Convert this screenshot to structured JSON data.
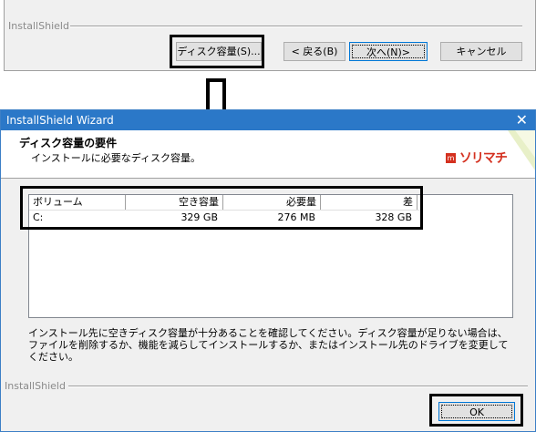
{
  "top_dialog": {
    "footer_label": "InstallShield",
    "buttons": {
      "disk_space": "ディスク容量(S)...",
      "back": "< 戻る(B)",
      "next": "次へ(N)>",
      "cancel": "キャンセル"
    }
  },
  "wizard": {
    "window_title": "InstallShield Wizard",
    "close_glyph": "✕",
    "header_title": "ディスク容量の要件",
    "header_subtitle": "インストールに必要なディスク容量。",
    "logo_mark": "m",
    "logo_text": "ソリマチ",
    "table": {
      "columns": [
        "ボリューム",
        "空き容量",
        "必要量",
        "差"
      ],
      "rows": [
        {
          "volume": "C:",
          "free": "329 GB",
          "required": "276 MB",
          "difference": "328 GB"
        }
      ]
    },
    "description": "インストール先に空きディスク容量が十分あることを確認してください。ディスク容量が足りない場合は、ファイルを削除するか、機能を減らしてインストールするか、またはインストール先のドライブを変更してください。",
    "footer_label": "InstallShield",
    "ok_label": "OK"
  },
  "colors": {
    "titlebar": "#2b78c8",
    "brand": "#d4301f",
    "highlight": "#000000"
  }
}
